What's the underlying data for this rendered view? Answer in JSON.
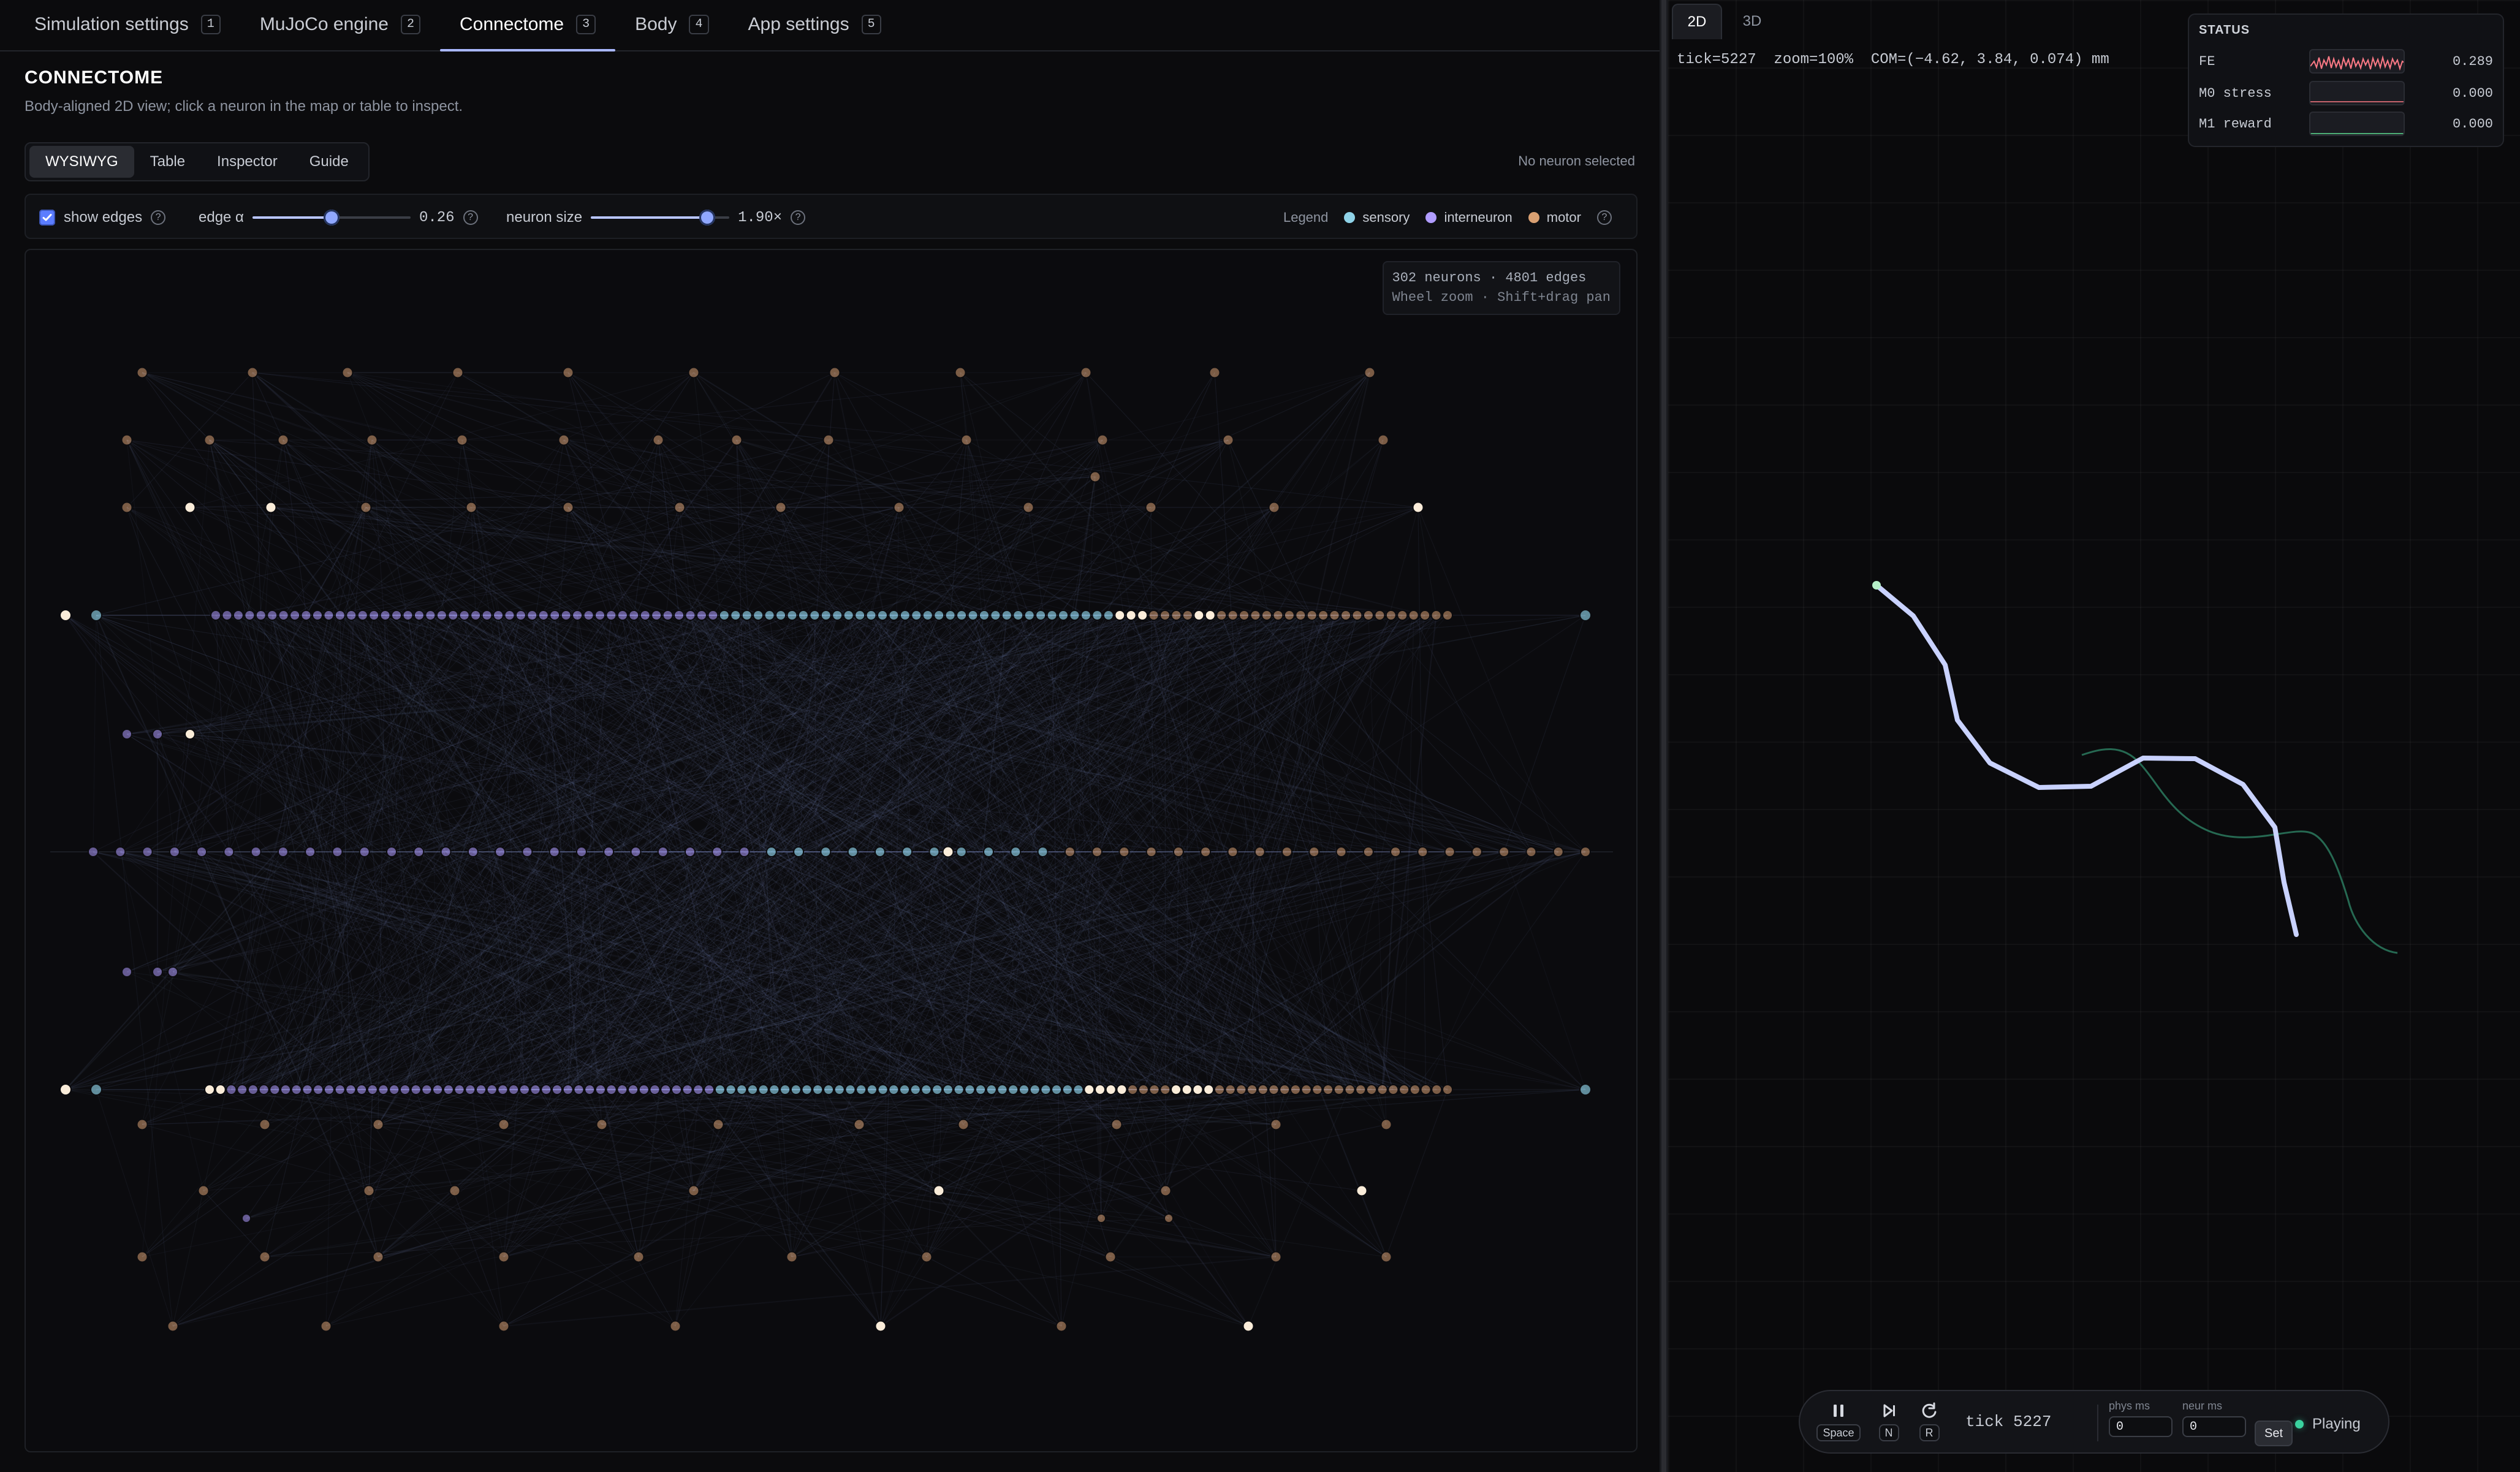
{
  "top_tabs": [
    {
      "label": "Simulation settings",
      "kbd": "1"
    },
    {
      "label": "MuJoCo engine",
      "kbd": "2"
    },
    {
      "label": "Connectome",
      "kbd": "3",
      "active": true
    },
    {
      "label": "Body",
      "kbd": "4"
    },
    {
      "label": "App settings",
      "kbd": "5"
    }
  ],
  "connectome": {
    "title": "CONNECTOME",
    "subtitle": "Body-aligned 2D view; click a neuron in the map or table to inspect.",
    "subtabs": [
      {
        "label": "WYSIWYG",
        "active": true
      },
      {
        "label": "Table"
      },
      {
        "label": "Inspector"
      },
      {
        "label": "Guide"
      }
    ],
    "selection_status": "No neuron selected",
    "controls": {
      "show_edges_label": "show edges",
      "show_edges_checked": true,
      "edge_alpha_label": "edge α",
      "edge_alpha_value": "0.26",
      "edge_alpha_fraction": 0.5,
      "neuron_size_label": "neuron size",
      "neuron_size_value": "1.90×",
      "neuron_size_fraction": 0.84
    },
    "legend": {
      "label": "Legend",
      "items": [
        {
          "label": "sensory",
          "color": "#8fd3e8"
        },
        {
          "label": "interneuron",
          "color": "#b09cff"
        },
        {
          "label": "motor",
          "color": "#d9a072"
        }
      ]
    },
    "map_info": {
      "line1": "302 neurons · 4801 edges",
      "line2": "Wheel zoom · Shift+drag pan"
    }
  },
  "viewer": {
    "tabs": [
      {
        "label": "2D",
        "active": true
      },
      {
        "label": "3D"
      }
    ],
    "readout": "tick=5227  zoom=100%  COM=(−4.62, 3.84, 0.074) mm",
    "status": {
      "title": "STATUS",
      "rows": [
        {
          "label": "FE",
          "value": "0.289",
          "spark_color": "#ff7a86"
        },
        {
          "label": "M0 stress",
          "value": "0.000",
          "spark_color": "#ff7a86"
        },
        {
          "label": "M1 reward",
          "value": "0.000",
          "spark_color": "#5ad28c"
        }
      ]
    },
    "player": {
      "space_key": "Space",
      "next_key": "N",
      "reset_key": "R",
      "tick_text": "tick 5227",
      "phys_ms_label": "phys ms",
      "neur_ms_label": "neur ms",
      "phys_ms_value": "0",
      "neur_ms_value": "0",
      "set_label": "Set",
      "state": "Playing"
    }
  }
}
